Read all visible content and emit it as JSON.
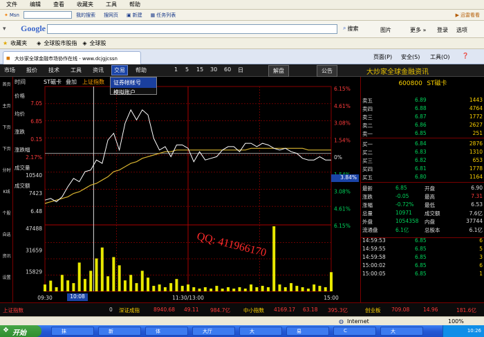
{
  "browser": {
    "menu": [
      "文件",
      "编辑",
      "查看",
      "收藏夹",
      "工具",
      "帮助"
    ],
    "links": [
      {
        "label": "Msn",
        "icon": "msn-icon"
      },
      {
        "label": "我的搜索",
        "icon": "search-icon"
      },
      {
        "label": "搜网页",
        "icon": "web-icon"
      },
      {
        "label": "新建",
        "icon": "new-icon"
      },
      {
        "label": "任务列表",
        "icon": "list-icon"
      }
    ],
    "links_right": "迅雷看看",
    "google_label": "Google",
    "search_btn": "搜索",
    "toolbar_right": [
      "图片",
      "更多 »",
      "登录",
      "选项"
    ],
    "fav_label": "收藏夹",
    "fav_links": [
      "全球股市股指",
      "全球股"
    ],
    "tab_title": "大炒家全球金融市场协作在线 - www.dcjgjcssn",
    "tab_tools": [
      "页面(P)",
      "安全(S)",
      "工具(O)"
    ],
    "status_text": "Internet",
    "zoom": "100%"
  },
  "app": {
    "menu": [
      "市场",
      "报价",
      "技术",
      "工具",
      "资讯",
      "交易",
      "帮助"
    ],
    "menu_active": "交易",
    "periods": [
      "1",
      "5",
      "15",
      "30",
      "60",
      "日"
    ],
    "btn_jiepan": "解盘",
    "btn_gonggao": "公告",
    "brand": "大炒家全球金融资讯",
    "dropdown": [
      "证券帐帐号",
      "模拟账户"
    ],
    "left_strip": [
      "首页",
      "主页",
      "下页",
      "下页",
      "分时",
      "K线",
      "个股",
      "自选",
      "资讯",
      "设置"
    ],
    "chart_header": {
      "time_label": "时间",
      "stock": "ST磁卡",
      "overlay": "叠加",
      "index": "上证指数"
    },
    "left_labels": [
      {
        "label": "价格",
        "value": "7.05"
      },
      {
        "label": "均价",
        "value": "6.85"
      },
      {
        "label": "涨跌",
        "value": "0.15"
      },
      {
        "label": "涨跌幅",
        "value": "2.17%"
      },
      {
        "label": "成交量",
        "value": "10540"
      },
      {
        "label": "成交额",
        "value": "7423"
      },
      {
        "label": "",
        "value": "6.48"
      }
    ],
    "price_axis": [
      "7.05",
      "6.85",
      "6.65",
      "6.48"
    ],
    "pct_axis": [
      "6.15%",
      "4.61%",
      "3.08%",
      "1.54%",
      "0%",
      "1.54%",
      "3.08%",
      "4.61%",
      "6.15%"
    ],
    "vol_axis": [
      "47488",
      "31659",
      "15829"
    ],
    "current_pct": "3.84%",
    "watermark": "QQ: 411966170",
    "time_axis": [
      "09:30",
      "10:08",
      "11:30/13:00",
      "15:00"
    ],
    "cursor_time": "10:08",
    "chart_data": {
      "type": "line",
      "x_range": [
        "09:30",
        "15:00"
      ],
      "series": [
        {
          "values": [
            6.62,
            6.63,
            6.61,
            6.64,
            6.7,
            6.75,
            6.73,
            6.79,
            6.8,
            6.86,
            6.84,
            6.98,
            7.02,
            6.92,
            7.08,
            7.16,
            7.1,
            7.16,
            7.13,
            6.99,
            6.92,
            6.94,
            6.88,
            6.95,
            6.95,
            6.93,
            6.85,
            6.91,
            6.86,
            6.87,
            6.88,
            6.92,
            6.94,
            6.94,
            6.91,
            6.96,
            6.96,
            6.94,
            6.96,
            6.95,
            6.93,
            6.92,
            6.93,
            6.91,
            6.9,
            6.87,
            6.86,
            6.86,
            6.88,
            6.86,
            6.86
          ]
        },
        {
          "values": [
            6.6,
            6.61,
            6.62,
            6.63,
            6.64,
            6.66,
            6.67,
            6.69,
            6.71,
            6.72,
            6.74,
            6.76,
            6.79,
            6.8,
            6.82,
            6.84,
            6.85,
            6.87,
            6.88,
            6.89,
            6.9,
            6.91,
            6.91,
            6.92,
            6.92,
            6.92,
            6.92,
            6.92,
            6.92,
            6.92,
            6.92,
            6.92,
            6.92,
            6.92,
            6.92,
            6.92,
            6.93,
            6.93,
            6.93,
            6.93,
            6.93,
            6.93,
            6.93,
            6.93,
            6.93,
            6.93,
            6.92,
            6.92,
            6.92,
            6.92,
            6.92
          ]
        }
      ],
      "volume": [
        5000,
        7800,
        3000,
        12000,
        8000,
        6000,
        21000,
        9000,
        15000,
        24000,
        32000,
        11000,
        25000,
        19000,
        8000,
        12000,
        6000,
        15000,
        10000,
        4000,
        5000,
        3000,
        6000,
        9000,
        4000,
        5000,
        3000,
        2000,
        3000,
        2000,
        4000,
        2000,
        3000,
        2000,
        3000,
        2000,
        5000,
        3000,
        4000,
        3000,
        47488,
        5000,
        3000,
        6000,
        4000,
        3000,
        2000,
        5000,
        4000,
        3000,
        14000
      ],
      "ylim": [
        6.48,
        7.3
      ],
      "vol_ylim": [
        0,
        47488
      ]
    },
    "right": {
      "stock_code": "600800",
      "stock_name": "ST磁卡",
      "asks": [
        {
          "label": "卖五",
          "price": "6.89",
          "vol": "1443"
        },
        {
          "label": "卖四",
          "price": "6.88",
          "vol": "4764"
        },
        {
          "label": "卖三",
          "price": "6.87",
          "vol": "1772"
        },
        {
          "label": "卖二",
          "price": "6.86",
          "vol": "2627"
        },
        {
          "label": "卖一",
          "price": "6.85",
          "vol": "251"
        }
      ],
      "bids": [
        {
          "label": "买一",
          "price": "6.84",
          "vol": "2876"
        },
        {
          "label": "买二",
          "price": "6.83",
          "vol": "1310"
        },
        {
          "label": "买三",
          "price": "6.82",
          "vol": "653"
        },
        {
          "label": "买四",
          "price": "6.81",
          "vol": "1778"
        },
        {
          "label": "买五",
          "price": "6.80",
          "vol": "1164"
        }
      ],
      "stats": [
        {
          "l1": "最新",
          "v1": "6.85",
          "l2": "开盘",
          "v2": "6.90"
        },
        {
          "l1": "涨跌",
          "v1": "-0.05",
          "l2": "最高",
          "v2": "7.31"
        },
        {
          "l1": "涨幅",
          "v1": "-0.72%",
          "l2": "最低",
          "v2": "6.53"
        },
        {
          "l1": "总量",
          "v1": "10971",
          "l2": "成交额",
          "v2": "7.6亿"
        },
        {
          "l1": "外盘",
          "v1": "1054358",
          "l2": "内盘",
          "v2": "37744"
        },
        {
          "l1": "流通盘",
          "v1": "6.1亿",
          "l2": "总股本",
          "v2": "6.1亿"
        }
      ],
      "ticks": [
        {
          "time": "14:59:53",
          "price": "6.85",
          "vol": "6"
        },
        {
          "time": "14:59:55",
          "price": "6.85",
          "vol": "5"
        },
        {
          "time": "14:59:58",
          "price": "6.85",
          "vol": "3"
        },
        {
          "time": "15:00:02",
          "price": "6.85",
          "vol": "6"
        },
        {
          "time": "15:00:05",
          "price": "6.85",
          "vol": "1"
        }
      ]
    },
    "bottom": {
      "sh_label": "上证指数",
      "sh_value": "0",
      "sz_label": "深证成指",
      "sz_values": [
        "8940.68",
        "49.11",
        "984.7亿"
      ],
      "zx_label": "中小指数",
      "zx_values": [
        "4169.17",
        "63.18",
        "395.3亿"
      ],
      "cy_label": "创业板",
      "cy_values": [
        "709.08",
        "14.96",
        "181.6亿"
      ]
    }
  },
  "taskbar": {
    "start": "开始",
    "tasks": [
      "抹",
      "新",
      "体",
      "大厅",
      "大",
      "易",
      "C",
      "大"
    ],
    "clock": "10:26"
  },
  "colors": {
    "up": "#ff3b3b",
    "down": "#00d25a",
    "gold": "#e8c200",
    "line": "#ffffff",
    "avg": "#d8b430",
    "vol": "#e8e800"
  }
}
